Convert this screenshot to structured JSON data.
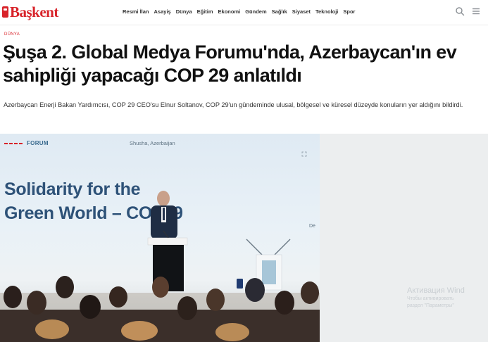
{
  "site": {
    "logo_text": "Başkent",
    "brand_color": "#d8232a"
  },
  "nav": {
    "items": [
      "Resmi İlan",
      "Asayiş",
      "Dünya",
      "Eğitim",
      "Ekonomi",
      "Gündem",
      "Sağlık",
      "Siyaset",
      "Teknoloji",
      "Spor"
    ]
  },
  "header_icons": [
    "search-icon",
    "menu-icon"
  ],
  "article": {
    "category": "DÜNYA",
    "title": "Şuşa 2. Global Medya Forumu'nda, Azerbaycan'ın ev sahipliği yapacağı COP 29 anlatıldı",
    "summary": "Azerbaycan Enerji Bakan Yardımcısı, COP 29 CEO'su Elnur Soltanov, COP 29'un gündeminde ulusal, bölgesel ve küresel düzeyde konuların yer aldığını bildirdi."
  },
  "photo": {
    "forum_label": "FORUM",
    "location": "Shusha, Azerbaijan",
    "slide_title_line1": "Solidarity for the",
    "slide_title_line2": "Green World – COP29",
    "side_label": "De"
  },
  "system_overlay": {
    "line1": "Активация Wind",
    "line2": "Чтобы активировать",
    "line3": "раздел \"Параметры\""
  }
}
